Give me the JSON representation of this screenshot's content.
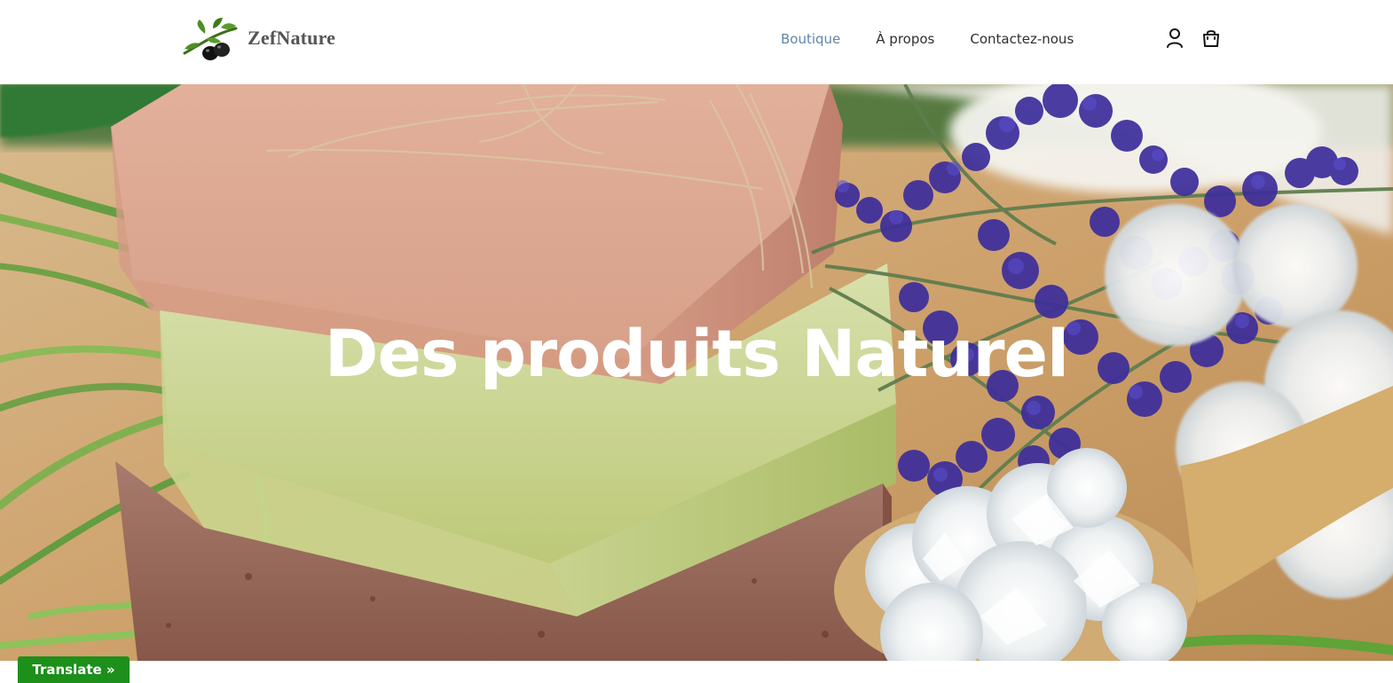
{
  "brand": {
    "name": "ZefNature"
  },
  "nav": {
    "items": [
      {
        "label": "Boutique",
        "active": true
      },
      {
        "label": "À propos",
        "active": false
      },
      {
        "label": "Contactez-nous",
        "active": false
      }
    ]
  },
  "header": {
    "icons": {
      "account": "user-icon",
      "cart": "shopping-bag-icon"
    }
  },
  "hero": {
    "title": "Des produits Naturel"
  },
  "translate": {
    "label": "Translate »"
  },
  "colors": {
    "accent": "#5f86a9",
    "translate_button": "#1d8f1b"
  }
}
